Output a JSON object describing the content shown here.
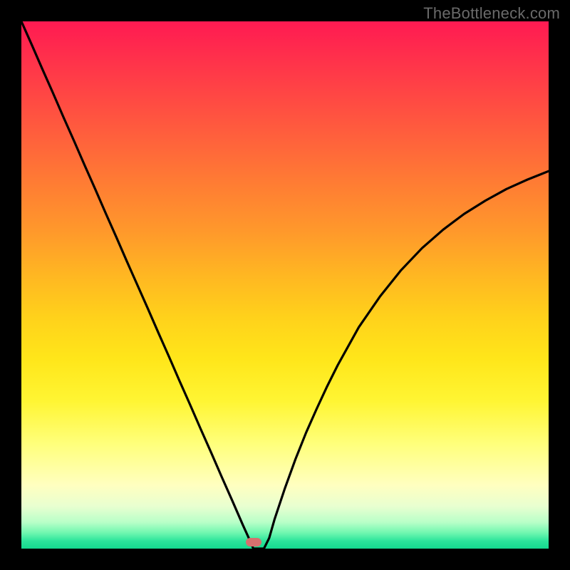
{
  "watermark": "TheBottleneck.com",
  "gradient_colors": {
    "top": "#ff1a52",
    "mid_orange": "#ff992b",
    "mid_yellow": "#ffe61a",
    "pale": "#ffffc0",
    "green": "#14d98f"
  },
  "marker": {
    "color": "#d6706e",
    "x_frac": 0.44,
    "y_frac": 0.988
  },
  "chart_data": {
    "type": "line",
    "title": "",
    "xlabel": "",
    "ylabel": "",
    "xlim": [
      0,
      1
    ],
    "ylim": [
      0,
      1
    ],
    "x": [
      0.0,
      0.02,
      0.04,
      0.06,
      0.08,
      0.1,
      0.12,
      0.14,
      0.16,
      0.18,
      0.2,
      0.22,
      0.24,
      0.26,
      0.28,
      0.3,
      0.32,
      0.34,
      0.36,
      0.38,
      0.4,
      0.41,
      0.42,
      0.43,
      0.44,
      0.45,
      0.46,
      0.47,
      0.48,
      0.5,
      0.52,
      0.54,
      0.56,
      0.58,
      0.6,
      0.64,
      0.68,
      0.72,
      0.76,
      0.8,
      0.84,
      0.88,
      0.92,
      0.96,
      1.0
    ],
    "values": [
      1.0,
      0.955,
      0.909,
      0.864,
      0.818,
      0.773,
      0.727,
      0.682,
      0.636,
      0.591,
      0.545,
      0.5,
      0.455,
      0.409,
      0.364,
      0.318,
      0.273,
      0.227,
      0.182,
      0.136,
      0.091,
      0.068,
      0.045,
      0.023,
      0.0,
      0.0,
      0.0,
      0.02,
      0.055,
      0.115,
      0.17,
      0.22,
      0.265,
      0.308,
      0.348,
      0.42,
      0.478,
      0.528,
      0.57,
      0.605,
      0.635,
      0.66,
      0.682,
      0.7,
      0.716
    ],
    "minimum_at_x": 0.44,
    "notes": "V-shaped bottleneck curve on rainbow gradient background; single dull-red marker at the minimum near the bottom."
  }
}
